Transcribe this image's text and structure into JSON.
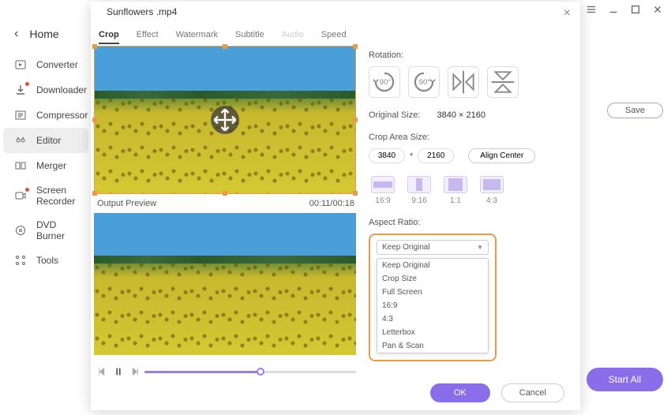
{
  "app": {
    "home": "Home"
  },
  "sidebar": {
    "items": [
      {
        "label": "Converter"
      },
      {
        "label": "Downloader"
      },
      {
        "label": "Compressor"
      },
      {
        "label": "Editor"
      },
      {
        "label": "Merger"
      },
      {
        "label": "Screen Recorder"
      },
      {
        "label": "DVD Burner"
      },
      {
        "label": "Tools"
      }
    ]
  },
  "main": {
    "save": "Save",
    "start_all": "Start All"
  },
  "dialog": {
    "title": "Sunflowers .mp4",
    "tabs": {
      "crop": "Crop",
      "effect": "Effect",
      "watermark": "Watermark",
      "subtitle": "Subtitle",
      "audio": "Audio",
      "speed": "Speed"
    },
    "output_preview": "Output Preview",
    "time": "00:11/00:18",
    "rotation_label": "Rotation:",
    "rotate_left": "90°",
    "rotate_right": "90°",
    "original_size_label": "Original Size:",
    "original_size_value": "3840 × 2160",
    "crop_area_label": "Crop Area Size:",
    "crop_w": "3840",
    "crop_star": "*",
    "crop_h": "2160",
    "align_center": "Align Center",
    "ratios": {
      "r1": "16:9",
      "r2": "9:16",
      "r3": "1:1",
      "r4": "4:3"
    },
    "aspect_label": "Aspect Ratio:",
    "aspect_selected": "Keep Original",
    "aspect_options": [
      "Keep Original",
      "Crop Size",
      "Full Screen",
      "16:9",
      "4:3",
      "Letterbox",
      "Pan & Scan"
    ],
    "ok": "OK",
    "cancel": "Cancel"
  }
}
